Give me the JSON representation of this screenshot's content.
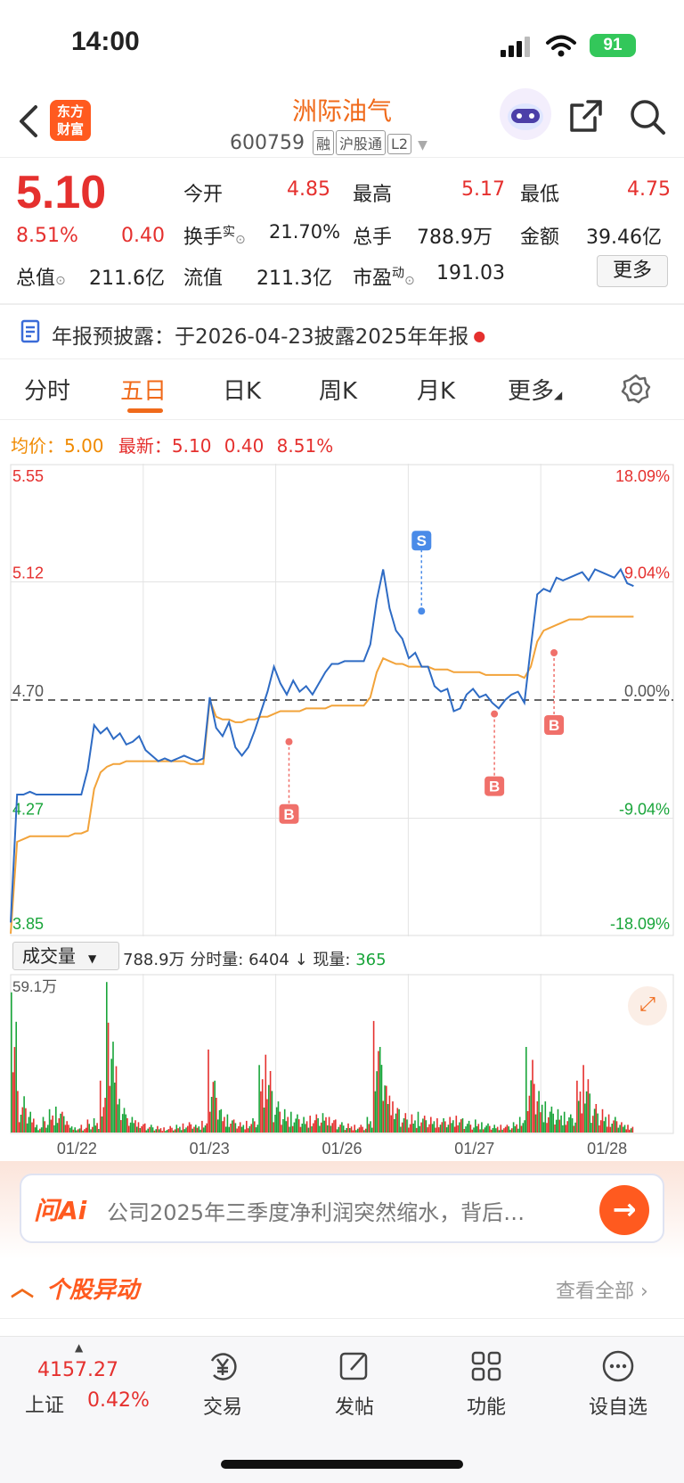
{
  "status_bar": {
    "time": "14:00",
    "battery": "91"
  },
  "header": {
    "logo": "东方财富",
    "stock_name": "洲际油气",
    "stock_code": "600759",
    "tags": [
      "融",
      "沪股通",
      "L2"
    ]
  },
  "quote": {
    "price": "5.10",
    "change_pct": "8.51%",
    "change": "0.40",
    "fields": {
      "open_label": "今开",
      "open": "4.85",
      "high_label": "最高",
      "high": "5.17",
      "low_label": "最低",
      "low": "4.75",
      "turnover_label": "换手",
      "turnover_sup": "实",
      "turnover": "21.70%",
      "volume_label": "总手",
      "volume": "788.9万",
      "amount_label": "金额",
      "amount": "39.46亿",
      "mktcap_label": "总值",
      "mktcap": "211.6亿",
      "float_label": "流值",
      "float": "211.3亿",
      "pe_label": "市盈",
      "pe_sup": "动",
      "pe": "191.03"
    },
    "more_button": "更多"
  },
  "notice": {
    "text": "年报预披露：于2026-04-23披露2025年年报"
  },
  "tabs": [
    "分时",
    "五日",
    "日K",
    "周K",
    "月K",
    "更多"
  ],
  "active_tab": "五日",
  "chart_header": {
    "avg_label": "均价：",
    "avg": "5.00",
    "latest_label": "最新：",
    "latest": "5.10",
    "change": "0.40",
    "change_pct": "8.51%"
  },
  "chart_data": {
    "type": "line",
    "days": [
      "01/22",
      "01/23",
      "01/26",
      "01/27",
      "01/28"
    ],
    "y_ticks_left": [
      "5.55",
      "5.12",
      "4.70",
      "4.27",
      "3.85"
    ],
    "y_ticks_right": [
      "18.09%",
      "9.04%",
      "0.00%",
      "-9.04%",
      "-18.09%"
    ],
    "ylim": [
      3.85,
      5.55
    ],
    "prev_close": 4.7,
    "series": [
      {
        "values": [
          3.9,
          4.36,
          4.36,
          4.37,
          4.36,
          4.36,
          4.36,
          4.36,
          4.36,
          4.36,
          4.36,
          4.36,
          4.45,
          4.61,
          4.58,
          4.6,
          4.56,
          4.58,
          4.54,
          4.55,
          4.57,
          4.52,
          4.5,
          4.48,
          4.49,
          4.48,
          4.49,
          4.5,
          4.49,
          4.48,
          4.49,
          4.71,
          4.6,
          4.57,
          4.62,
          4.53,
          4.5,
          4.53,
          4.59,
          4.66,
          4.73,
          4.82,
          4.76,
          4.72,
          4.77,
          4.73,
          4.75,
          4.72,
          4.76,
          4.8,
          4.83,
          4.83,
          4.84,
          4.84,
          4.84,
          4.84,
          4.9,
          5.06,
          5.17,
          5.03,
          4.95,
          4.92,
          4.85,
          4.87,
          4.82,
          4.82,
          4.75,
          4.73,
          4.74,
          4.66,
          4.67,
          4.72,
          4.74,
          4.71,
          4.72,
          4.69,
          4.67,
          4.7,
          4.72,
          4.73,
          4.69,
          4.89,
          5.08,
          5.1,
          5.09,
          5.14,
          5.13,
          5.14,
          5.15,
          5.16,
          5.13,
          5.17,
          5.16,
          5.15,
          5.14,
          5.17,
          5.12,
          5.11
        ]
      },
      {
        "values": [
          3.86,
          4.19,
          4.2,
          4.21,
          4.21,
          4.21,
          4.21,
          4.21,
          4.21,
          4.21,
          4.22,
          4.22,
          4.23,
          4.38,
          4.44,
          4.46,
          4.47,
          4.47,
          4.48,
          4.48,
          4.48,
          4.48,
          4.48,
          4.48,
          4.48,
          4.48,
          4.48,
          4.48,
          4.47,
          4.47,
          4.47,
          4.7,
          4.64,
          4.63,
          4.63,
          4.62,
          4.62,
          4.63,
          4.63,
          4.64,
          4.64,
          4.65,
          4.66,
          4.66,
          4.66,
          4.66,
          4.67,
          4.67,
          4.67,
          4.67,
          4.68,
          4.68,
          4.68,
          4.68,
          4.68,
          4.68,
          4.71,
          4.8,
          4.85,
          4.84,
          4.83,
          4.83,
          4.82,
          4.82,
          4.82,
          4.82,
          4.81,
          4.81,
          4.81,
          4.8,
          4.8,
          4.8,
          4.8,
          4.8,
          4.79,
          4.79,
          4.79,
          4.79,
          4.79,
          4.79,
          4.78,
          4.82,
          4.91,
          4.95,
          4.96,
          4.97,
          4.98,
          4.99,
          4.99,
          4.99,
          5.0,
          5.0,
          5.0,
          5.0,
          5.0,
          5.0,
          5.0,
          5.0
        ]
      }
    ],
    "markers": [
      {
        "label": "B",
        "day_index": 2,
        "price": 4.55
      },
      {
        "label": "S",
        "day_index": 3,
        "price": 5.02
      },
      {
        "label": "B",
        "day_index": 3,
        "price": 4.65
      },
      {
        "label": "B",
        "day_index": 4,
        "price": 4.87
      }
    ]
  },
  "volume_section": {
    "selector": "成交量",
    "total": "788.9万",
    "tick_label": "分时量:",
    "tick_value": "6404",
    "now_label": "现量:",
    "now_value": "365",
    "max_label": "59.1万"
  },
  "volume_data": {
    "values": [
      540,
      160,
      140,
      80,
      30,
      60,
      90,
      100,
      80,
      30,
      20,
      30,
      50,
      55,
      200,
      580,
      350,
      130,
      70,
      60,
      40,
      35,
      30,
      25,
      20,
      25,
      30,
      35,
      40,
      30,
      45,
      320,
      200,
      90,
      70,
      50,
      40,
      45,
      55,
      260,
      300,
      160,
      120,
      90,
      80,
      70,
      60,
      65,
      70,
      75,
      60,
      50,
      40,
      35,
      30,
      30,
      60,
      430,
      330,
      180,
      120,
      90,
      75,
      70,
      80,
      65,
      60,
      55,
      55,
      60,
      65,
      55,
      45,
      50,
      40,
      35,
      30,
      30,
      30,
      40,
      60,
      330,
      280,
      160,
      120,
      100,
      90,
      80,
      70,
      200,
      260,
      150,
      110,
      90,
      70,
      60,
      40,
      30
    ],
    "colors": [
      "r",
      "r",
      "g",
      "r",
      "g",
      "g",
      "r",
      "g",
      "r",
      "g",
      "g",
      "r",
      "g",
      "g",
      "r",
      "r",
      "g",
      "g",
      "r",
      "g",
      "r",
      "g",
      "g",
      "r",
      "g",
      "r",
      "g",
      "g",
      "r",
      "g",
      "g",
      "r",
      "g",
      "r",
      "g",
      "r",
      "g",
      "r",
      "g",
      "r",
      "r",
      "g",
      "r",
      "g",
      "g",
      "r",
      "g",
      "r",
      "g",
      "g",
      "r",
      "g",
      "g",
      "r",
      "g",
      "r",
      "g",
      "g",
      "g",
      "r",
      "g",
      "g",
      "r",
      "g",
      "g",
      "r",
      "g",
      "r",
      "g",
      "g",
      "r",
      "g",
      "r",
      "g",
      "g",
      "r",
      "g",
      "r",
      "g",
      "g",
      "g",
      "r",
      "r",
      "g",
      "r",
      "g",
      "g",
      "r",
      "g",
      "r",
      "g",
      "g",
      "r",
      "g",
      "r",
      "g",
      "g",
      "r"
    ]
  },
  "ai_bar": {
    "brand": "问Ai",
    "prompt": "公司2025年三季度净利润突然缩水，背后…"
  },
  "abnormal": {
    "title": "个股异动",
    "view_all": "查看全部"
  },
  "bottom_nav": {
    "index_value": "4157.27",
    "index_name": "上证",
    "index_change": "0.42%",
    "items": [
      "交易",
      "发帖",
      "功能",
      "设自选"
    ]
  }
}
